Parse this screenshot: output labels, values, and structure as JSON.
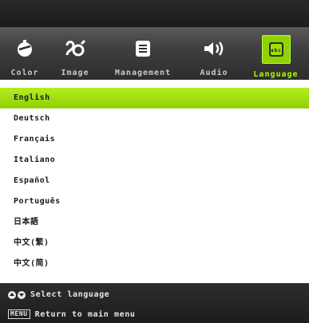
{
  "menu": {
    "tabs": [
      {
        "label": "Color",
        "icon": "color-icon"
      },
      {
        "label": "Image",
        "icon": "image-icon"
      },
      {
        "label": "Management",
        "icon": "management-icon"
      },
      {
        "label": "Audio",
        "icon": "audio-icon"
      },
      {
        "label": "Language",
        "icon": "language-icon",
        "active": true
      }
    ]
  },
  "languages": [
    {
      "label": "English",
      "selected": true
    },
    {
      "label": "Deutsch"
    },
    {
      "label": "Français"
    },
    {
      "label": "Italiano"
    },
    {
      "label": "Español"
    },
    {
      "label": "Português"
    },
    {
      "label": "日本語"
    },
    {
      "label": "中文(繁)"
    },
    {
      "label": "中文(简)"
    }
  ],
  "footer": {
    "hint1": "Select language",
    "menu_key": "MENU",
    "hint2": "Return to main menu"
  },
  "colors": {
    "accent": "#9fe000",
    "active_label": "#a8ff00",
    "bar": "#3f3f3f"
  }
}
